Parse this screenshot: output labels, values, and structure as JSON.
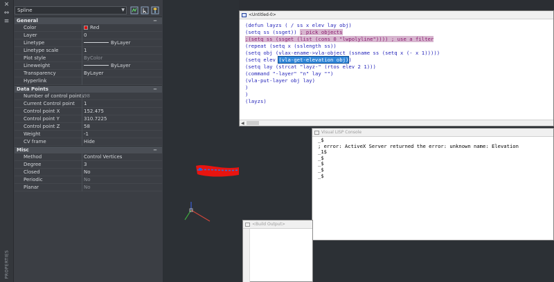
{
  "palette": {
    "object_type": "Spline",
    "side_title": "PROPERTIES",
    "sections": [
      {
        "title": "General",
        "rows": [
          {
            "label": "Color",
            "value": "Red",
            "kind": "color"
          },
          {
            "label": "Layer",
            "value": "0"
          },
          {
            "label": "Linetype",
            "value": "ByLayer",
            "kind": "line"
          },
          {
            "label": "Linetype scale",
            "value": "1"
          },
          {
            "label": "Plot style",
            "value": "ByColor",
            "dim": true
          },
          {
            "label": "Lineweight",
            "value": "ByLayer",
            "kind": "line"
          },
          {
            "label": "Transparency",
            "value": "ByLayer"
          },
          {
            "label": "Hyperlink",
            "value": ""
          }
        ]
      },
      {
        "title": "Data Points",
        "rows": [
          {
            "label": "Number of control points",
            "value": "98",
            "dim": true
          },
          {
            "label": "Current Control point",
            "value": "1"
          },
          {
            "label": "Control point X",
            "value": "152.475"
          },
          {
            "label": "Control point Y",
            "value": "310.7225"
          },
          {
            "label": "Control point Z",
            "value": "58"
          },
          {
            "label": "Weight",
            "value": "-1"
          },
          {
            "label": "CV frame",
            "value": "Hide"
          }
        ]
      },
      {
        "title": "Misc",
        "rows": [
          {
            "label": "Method",
            "value": "Control Vertices"
          },
          {
            "label": "Degree",
            "value": "3"
          },
          {
            "label": "Closed",
            "value": "No"
          },
          {
            "label": "Periodic",
            "value": "No",
            "dim": true
          },
          {
            "label": "Planar",
            "value": "No",
            "dim": true
          }
        ]
      }
    ],
    "collapse_glyph": "−"
  },
  "editor": {
    "title": "<Untitled-0>",
    "lines": [
      [
        {
          "t": "(defun layzs ( / ss x elev lay obj)"
        }
      ],
      [
        {
          "t": "(setq ss (ssget)) "
        },
        {
          "t": "; pick objects",
          "c": "cm"
        }
      ],
      [
        {
          "t": ";(setq ss (ssget (list (cons 0 \"lwpolyline\")))) ; use a filter",
          "c": "cm"
        }
      ],
      [
        {
          "t": "(repeat (setq x (sslength ss))"
        }
      ],
      [
        {
          "t": "(setq obj (vlax-ename->vla-object (ssname ss (setq x (- x 1)))))"
        }
      ],
      [
        {
          "t": "(setq elev "
        },
        {
          "t": "(vla-get-elevation obj)",
          "c": "sel"
        },
        {
          "t": ")"
        }
      ],
      [
        {
          "t": "(setq lay (strcat \"layz-\" (rtos elev 2 1)))"
        }
      ],
      [
        {
          "t": "(command \"-layer\" \"n\" lay \"\")"
        }
      ],
      [
        {
          "t": "(vla-put-layer obj lay)"
        }
      ],
      [
        {
          "t": ")"
        }
      ],
      [
        {
          "t": ")"
        }
      ],
      [
        {
          "t": "(layzs)"
        }
      ]
    ]
  },
  "console": {
    "title": "Visual LISP Console",
    "lines": [
      "_$",
      "; error: ActiveX Server returned the error: unknown name: Elevation",
      "_1$",
      "_$",
      "_$",
      "_$",
      "_$"
    ]
  },
  "build": {
    "title": "<Build Output>"
  },
  "colors": {
    "spline": "#e8140f",
    "axis_x": "#d0463a",
    "axis_y": "#3ea63e",
    "axis_z": "#3b5fd6"
  }
}
